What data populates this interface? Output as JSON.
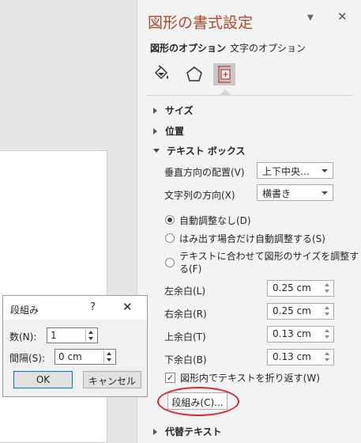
{
  "pane": {
    "title": "図形の書式設定",
    "dropdown_glyph": "▼",
    "close_glyph": "✕",
    "tabs": {
      "shape_options": "図形のオプション",
      "text_options": "文字のオプション"
    },
    "icons": [
      "fill-line-icon",
      "effects-icon",
      "size-properties-icon"
    ],
    "sections": {
      "size": "サイズ",
      "position": "位置",
      "textbox": "テキスト ボックス",
      "alt_text": "代替テキスト"
    },
    "textbox": {
      "vertical_align_label": "垂直方向の配置(V)",
      "vertical_align_value": "上下中央…",
      "text_direction_label": "文字列の方向(X)",
      "text_direction_value": "横書き",
      "autofit_options": [
        {
          "label": "自動調整なし(D)",
          "checked": true
        },
        {
          "label": "はみ出す場合だけ自動調整する(S)",
          "checked": false
        },
        {
          "label_line1": "テキストに合わせて図形のサイズを調整す",
          "label_line2": "る(F)",
          "checked": false
        }
      ],
      "margins": [
        {
          "label": "左余白(L)",
          "value": "0.25 cm"
        },
        {
          "label": "右余白(R)",
          "value": "0.25 cm"
        },
        {
          "label": "上余白(T)",
          "value": "0.13 cm"
        },
        {
          "label": "下余白(B)",
          "value": "0.13 cm"
        }
      ],
      "wrap_text_label": "図形内でテキストを折り返す(W)",
      "wrap_text_checked": true,
      "columns_button": "段組み(C)..."
    }
  },
  "dialog": {
    "title": "段組み",
    "help_glyph": "?",
    "close_glyph": "✕",
    "number_label": "数(N):",
    "number_value": "1",
    "spacing_label": "間隔(S):",
    "spacing_value": "0 cm",
    "ok": "OK",
    "cancel": "キャンセル"
  },
  "colors": {
    "title_accent": "#b7472a",
    "highlight_ring": "#e2262b"
  }
}
